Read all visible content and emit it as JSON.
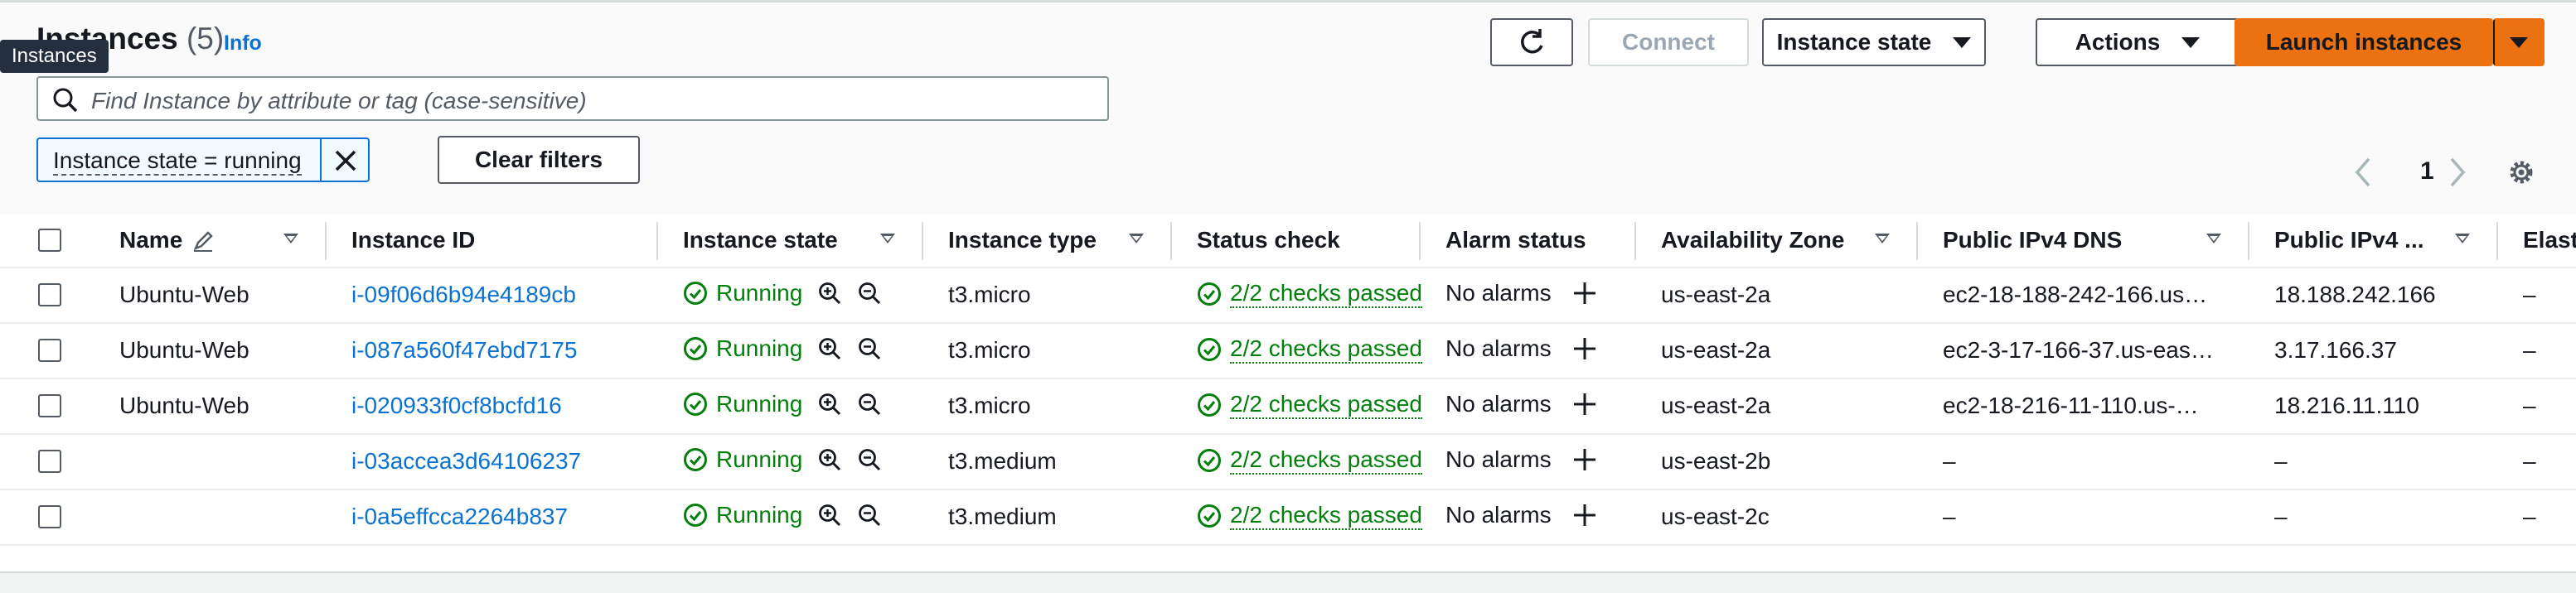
{
  "header": {
    "title": "Instances",
    "count": "(5)",
    "info": "Info",
    "tooltip": "Instances"
  },
  "toolbar": {
    "connect": "Connect",
    "instance_state": "Instance state",
    "actions": "Actions",
    "launch": "Launch instances"
  },
  "search": {
    "placeholder": "Find Instance by attribute or tag (case-sensitive)"
  },
  "filter": {
    "token": "Instance state = running",
    "clear": "Clear filters"
  },
  "pagination": {
    "page": "1"
  },
  "table": {
    "columns": {
      "name": "Name",
      "instance_id": "Instance ID",
      "instance_state": "Instance state",
      "instance_type": "Instance type",
      "status_check": "Status check",
      "alarm_status": "Alarm status",
      "availability_zone": "Availability Zone",
      "public_dns": "Public IPv4 DNS",
      "public_ip": "Public IPv4 ...",
      "elastic": "Elast"
    },
    "rows": [
      {
        "name": "Ubuntu-Web",
        "id": "i-09f06d6b94e4189cb",
        "state": "Running",
        "type": "t3.micro",
        "check": "2/2 checks passed",
        "alarm": "No alarms",
        "az": "us-east-2a",
        "dns": "ec2-18-188-242-166.us…",
        "ip": "18.188.242.166",
        "elastic": "–"
      },
      {
        "name": "Ubuntu-Web",
        "id": "i-087a560f47ebd7175",
        "state": "Running",
        "type": "t3.micro",
        "check": "2/2 checks passed",
        "alarm": "No alarms",
        "az": "us-east-2a",
        "dns": "ec2-3-17-166-37.us-eas…",
        "ip": "3.17.166.37",
        "elastic": "–"
      },
      {
        "name": "Ubuntu-Web",
        "id": "i-020933f0cf8bcfd16",
        "state": "Running",
        "type": "t3.micro",
        "check": "2/2 checks passed",
        "alarm": "No alarms",
        "az": "us-east-2a",
        "dns": "ec2-18-216-11-110.us-…",
        "ip": "18.216.11.110",
        "elastic": "–"
      },
      {
        "name": "",
        "id": "i-03accea3d64106237",
        "state": "Running",
        "type": "t3.medium",
        "check": "2/2 checks passed",
        "alarm": "No alarms",
        "az": "us-east-2b",
        "dns": "–",
        "ip": "–",
        "elastic": "–"
      },
      {
        "name": "",
        "id": "i-0a5effcca2264b837",
        "state": "Running",
        "type": "t3.medium",
        "check": "2/2 checks passed",
        "alarm": "No alarms",
        "az": "us-east-2c",
        "dns": "–",
        "ip": "–",
        "elastic": "–"
      }
    ]
  },
  "colors": {
    "accent": "#0972d3",
    "primary": "#ec7211",
    "success": "#037f0c"
  }
}
